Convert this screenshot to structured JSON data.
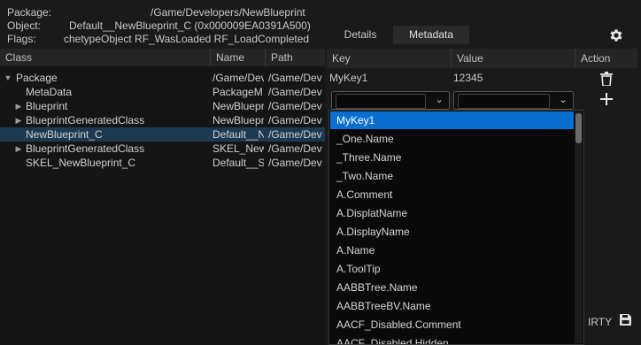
{
  "info": {
    "package_label": "Package:",
    "package_value": "/Game/Developers/NewBlueprint",
    "object_label": "Object:",
    "object_value": "Default__NewBlueprint_C (0x000009EA0391A500)",
    "flags_label": "Flags:",
    "flags_value": "chetypeObject RF_WasLoaded RF_LoadCompleted"
  },
  "tree": {
    "headers": {
      "class": "Class",
      "name": "Name",
      "path": "Path"
    },
    "rows": [
      {
        "class": "Package",
        "name": "/Game/Dev",
        "path": "/Game/Dev",
        "arrow": "down"
      },
      {
        "class": "MetaData",
        "name": "PackageM",
        "path": "/Game/Dev",
        "arrow": ""
      },
      {
        "class": "Blueprint",
        "name": "NewBluepr",
        "path": "/Game/Dev",
        "arrow": "right"
      },
      {
        "class": "BlueprintGeneratedClass",
        "name": "NewBluepr",
        "path": "/Game/Dev",
        "arrow": "right"
      },
      {
        "class": "NewBlueprint_C",
        "name": "Default__N",
        "path": "/Game/Dev",
        "arrow": "",
        "selected": true
      },
      {
        "class": "BlueprintGeneratedClass",
        "name": "SKEL_New",
        "path": "/Game/Dev",
        "arrow": "right"
      },
      {
        "class": "SKEL_NewBlueprint_C",
        "name": "Default__Sl",
        "path": "/Game/Dev",
        "arrow": ""
      }
    ]
  },
  "tabs": {
    "details": "Details",
    "metadata": "Metadata"
  },
  "meta_table": {
    "headers": {
      "key": "Key",
      "value": "Value",
      "action": "Action"
    },
    "row": {
      "key": "MyKey1",
      "value": "12345"
    }
  },
  "dropdown": {
    "items": [
      "MyKey1",
      "_One.Name",
      "_Three.Name",
      "_Two.Name",
      "A.Comment",
      "A.DisplatName",
      "A.DisplayName",
      "A.Name",
      "A.ToolTip",
      "AABBTree.Name",
      "AABBTreeBV.Name",
      "AACF_Disabled.Comment",
      "AACF_Disabled.Hidden"
    ],
    "highlighted_index": 0
  },
  "footer": {
    "status_text": "IRTY"
  },
  "icons": {
    "settings": "gear-icon",
    "delete": "trash-icon",
    "add": "plus-icon",
    "save": "save-icon"
  },
  "colors": {
    "highlight": "#0a6ed1",
    "selected_row": "#1e3a52"
  }
}
